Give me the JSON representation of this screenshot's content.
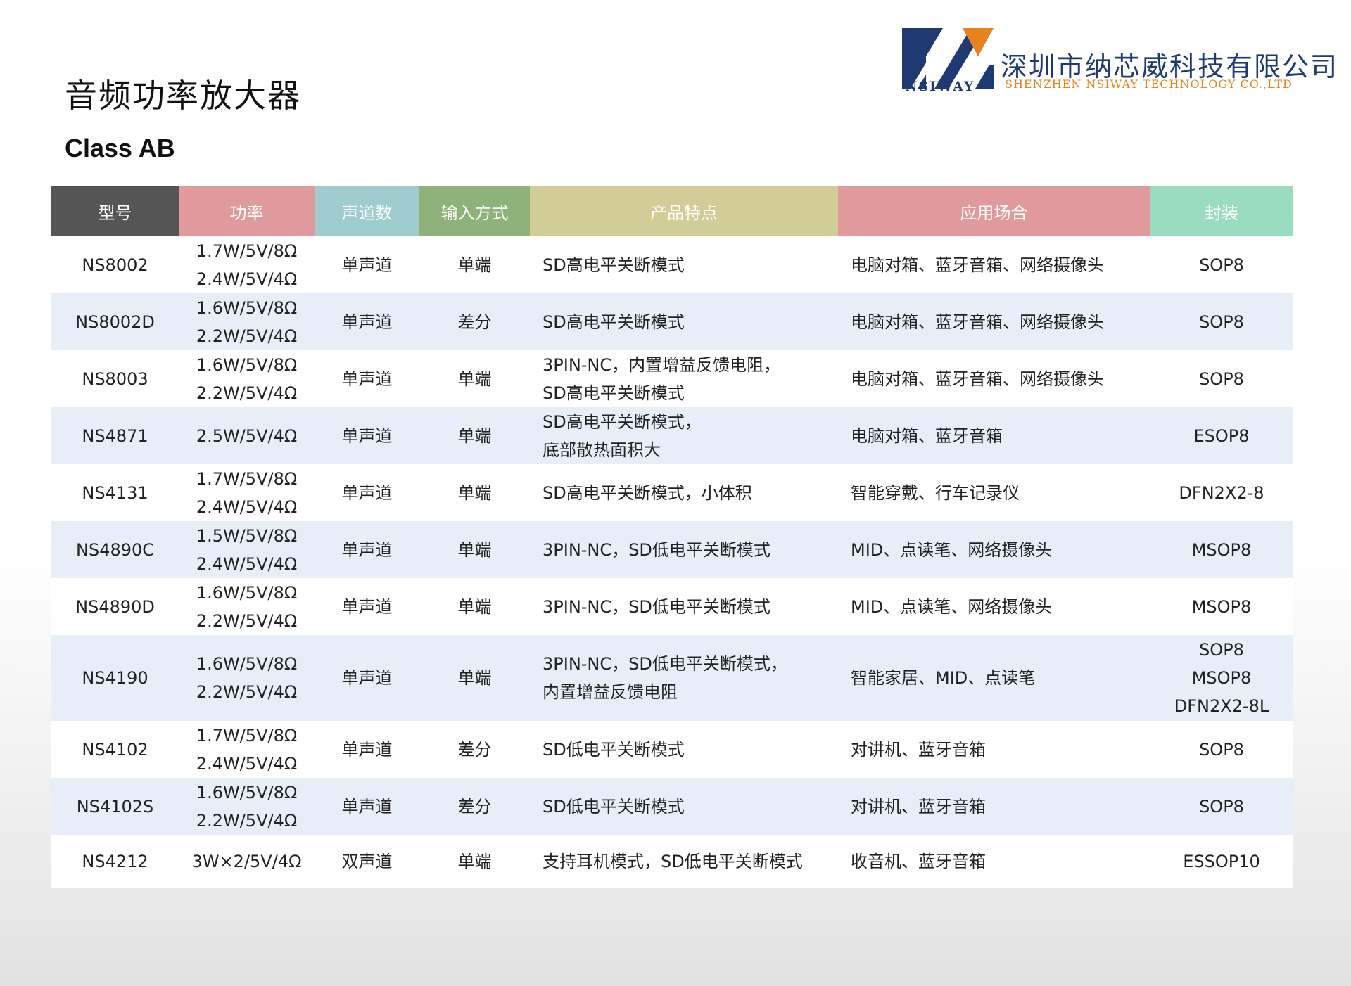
{
  "title": "音频功率放大器",
  "subtitle": "Class AB",
  "logo": {
    "abbr": "NSIWAY",
    "company_cn": "深圳市纳芯威科技有限公司",
    "company_en": "SHENZHEN  NSIWAY  TECHNOLOGY  CO.,LTD",
    "colors": {
      "navy": "#1f3a73",
      "orange": "#e8821e"
    }
  },
  "table": {
    "headers": [
      {
        "label": "型号",
        "color": "#555555"
      },
      {
        "label": "功率",
        "color": "#e19a9b"
      },
      {
        "label": "声道数",
        "color": "#9fcccf"
      },
      {
        "label": "输入方式",
        "color": "#8fb17a"
      },
      {
        "label": "产品特点",
        "color": "#d2cd96"
      },
      {
        "label": "应用场合",
        "color": "#e19a9b"
      },
      {
        "label": "封装",
        "color": "#99dcc0"
      }
    ],
    "rows": [
      {
        "model": "NS8002",
        "power": [
          "1.7W/5V/8Ω",
          "2.4W/5V/4Ω"
        ],
        "channels": "单声道",
        "input": "单端",
        "features": [
          "SD高电平关断模式"
        ],
        "application": "电脑对箱、蓝牙音箱、网络摄像头",
        "package": [
          "SOP8"
        ]
      },
      {
        "model": "NS8002D",
        "power": [
          "1.6W/5V/8Ω",
          "2.2W/5V/4Ω"
        ],
        "channels": "单声道",
        "input": "差分",
        "features": [
          "SD高电平关断模式"
        ],
        "application": "电脑对箱、蓝牙音箱、网络摄像头",
        "package": [
          "SOP8"
        ]
      },
      {
        "model": "NS8003",
        "power": [
          "1.6W/5V/8Ω",
          "2.2W/5V/4Ω"
        ],
        "channels": "单声道",
        "input": "单端",
        "features": [
          "3PIN-NC，内置增益反馈电阻，",
          "SD高电平关断模式"
        ],
        "application": "电脑对箱、蓝牙音箱、网络摄像头",
        "package": [
          "SOP8"
        ]
      },
      {
        "model": "NS4871",
        "power": [
          "2.5W/5V/4Ω"
        ],
        "channels": "单声道",
        "input": "单端",
        "features": [
          "SD高电平关断模式，",
          "底部散热面积大"
        ],
        "application": "电脑对箱、蓝牙音箱",
        "package": [
          "ESOP8"
        ]
      },
      {
        "model": "NS4131",
        "power": [
          "1.7W/5V/8Ω",
          "2.4W/5V/4Ω"
        ],
        "channels": "单声道",
        "input": "单端",
        "features": [
          "SD高电平关断模式，小体积"
        ],
        "application": "智能穿戴、行车记录仪",
        "package": [
          "DFN2X2-8"
        ]
      },
      {
        "model": "NS4890C",
        "power": [
          "1.5W/5V/8Ω",
          "2.4W/5V/4Ω"
        ],
        "channels": "单声道",
        "input": "单端",
        "features": [
          "3PIN-NC，SD低电平关断模式"
        ],
        "application": "MID、点读笔、网络摄像头",
        "package": [
          "MSOP8"
        ]
      },
      {
        "model": "NS4890D",
        "power": [
          "1.6W/5V/8Ω",
          "2.2W/5V/4Ω"
        ],
        "channels": "单声道",
        "input": "单端",
        "features": [
          "3PIN-NC，SD低电平关断模式"
        ],
        "application": "MID、点读笔、网络摄像头",
        "package": [
          "MSOP8"
        ]
      },
      {
        "model": "NS4190",
        "power": [
          "1.6W/5V/8Ω",
          "2.2W/5V/4Ω"
        ],
        "channels": "单声道",
        "input": "单端",
        "features": [
          "3PIN-NC，SD低电平关断模式，",
          "内置增益反馈电阻"
        ],
        "application": "智能家居、MID、点读笔",
        "package": [
          "SOP8",
          "MSOP8",
          "DFN2X2-8L"
        ]
      },
      {
        "model": "NS4102",
        "power": [
          "1.7W/5V/8Ω",
          "2.4W/5V/4Ω"
        ],
        "channels": "单声道",
        "input": "差分",
        "features": [
          "SD低电平关断模式"
        ],
        "application": "对讲机、蓝牙音箱",
        "package": [
          "SOP8"
        ]
      },
      {
        "model": "NS4102S",
        "power": [
          "1.6W/5V/8Ω",
          "2.2W/5V/4Ω"
        ],
        "channels": "单声道",
        "input": "差分",
        "features": [
          "SD低电平关断模式"
        ],
        "application": "对讲机、蓝牙音箱",
        "package": [
          "SOP8"
        ]
      },
      {
        "model": "NS4212",
        "power": [
          "3W×2/5V/4Ω"
        ],
        "channels": "双声道",
        "input": "单端",
        "features": [
          "支持耳机模式，SD低电平关断模式"
        ],
        "application": "收音机、蓝牙音箱",
        "package": [
          "ESSOP10"
        ]
      }
    ]
  }
}
